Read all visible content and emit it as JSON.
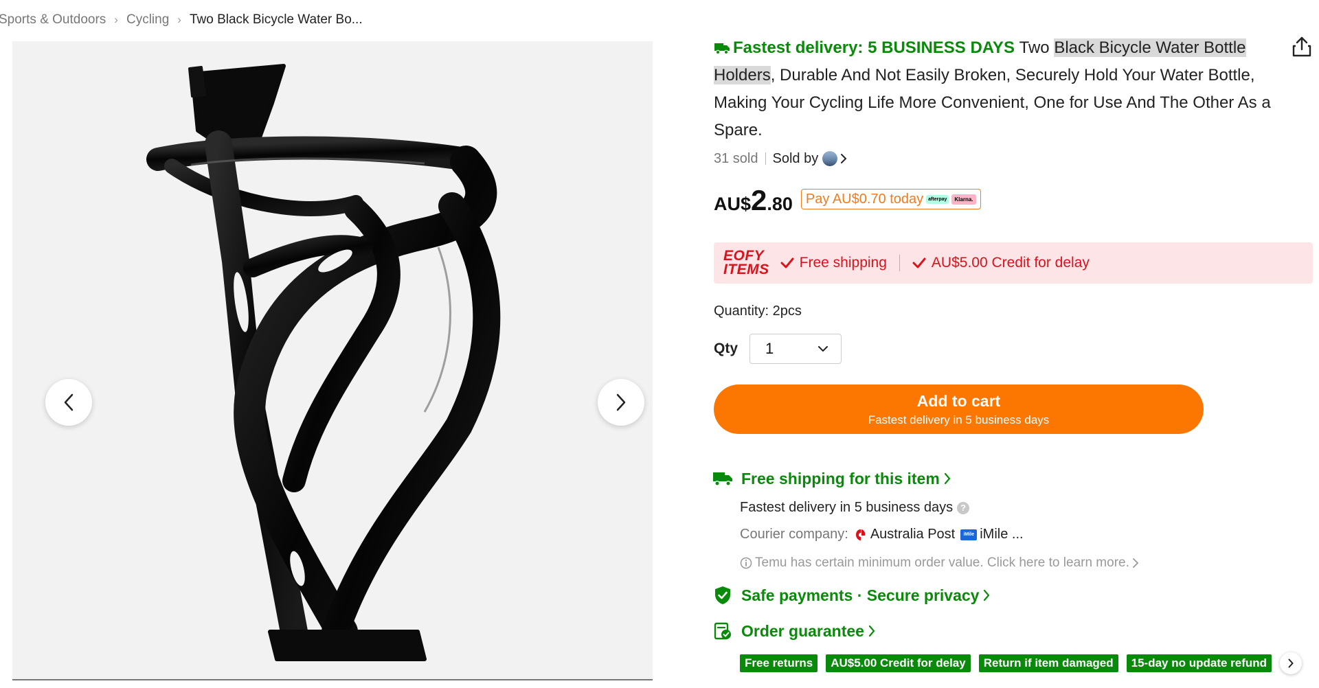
{
  "breadcrumb": {
    "items": [
      "Sports & Outdoors",
      "Cycling"
    ],
    "current": "Two Black Bicycle Water Bo..."
  },
  "product": {
    "fastest_delivery": "Fastest delivery: 5 BUSINESS DAYS",
    "title_part1": "Two ",
    "title_highlight": "Black Bicycle Water Bottle Holders",
    "title_part2": ", Durable And Not Easily Broken, Securely Hold Your Water Bottle, Making Your Cycling Life More Convenient, One for Use And The Other As a Spare.",
    "sold": "31 sold",
    "sold_by": "Sold by",
    "price_currency": "AU$",
    "price_int": "2",
    "price_dec": ".80",
    "pay_later": "Pay AU$0.70 today",
    "afterpay_badge": "afterpay",
    "klarna_badge": "Klarna."
  },
  "promo": {
    "eofy_line1": "EOFY",
    "eofy_line2": "ITEMS",
    "free_shipping": "Free shipping",
    "credit": "AU$5.00 Credit for delay"
  },
  "quantity": {
    "label": "Quantity:",
    "value": "2pcs",
    "qty_label": "Qty",
    "qty_selected": "1"
  },
  "cart": {
    "label": "Add to cart",
    "sub": "Fastest delivery in 5 business days"
  },
  "shipping": {
    "title": "Free shipping for this item",
    "fastest": "Fastest delivery in 5 business days",
    "help": "?",
    "courier_label": "Courier company:",
    "courier1": "Australia Post",
    "courier2": "iMile ...",
    "imile_logo": "iMile",
    "min_order": "Temu has certain minimum order value. Click here to learn more."
  },
  "safe": {
    "title": "Safe payments · Secure privacy"
  },
  "guarantee": {
    "title": "Order guarantee",
    "tags": [
      "Free returns",
      "AU$5.00 Credit for delay",
      "Return if item damaged",
      "15-day no update refund"
    ]
  },
  "colors": {
    "accent_orange": "#fb7701",
    "green": "#0a8a0a",
    "promo_red": "#d8131b",
    "promo_bg": "#fde5e7"
  },
  "icons": {
    "share": "share-icon",
    "prev": "chevron-left-icon",
    "next": "chevron-right-icon",
    "truck": "truck-icon",
    "shield": "shield-check-icon",
    "guarantee": "guarantee-icon",
    "info": "info-icon"
  }
}
